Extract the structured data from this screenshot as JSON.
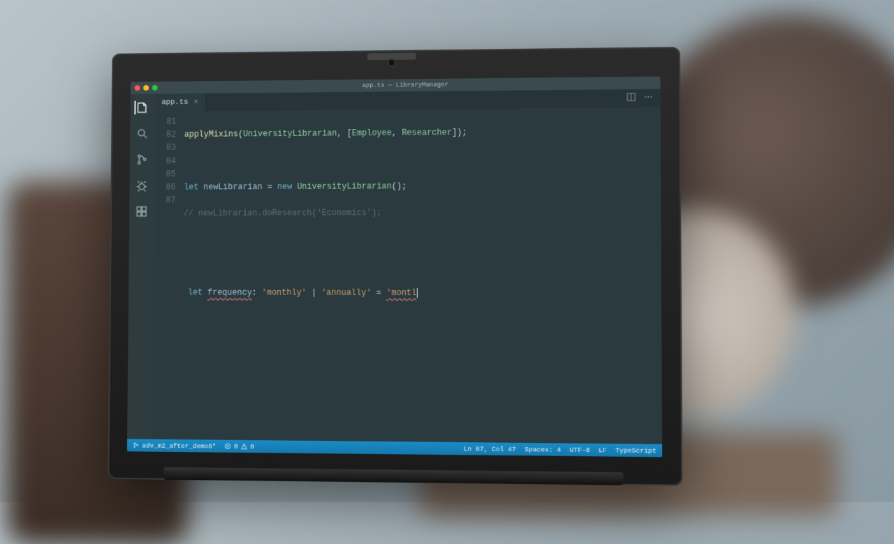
{
  "window": {
    "title": "app.ts — LibraryManager"
  },
  "tab": {
    "filename": "app.ts"
  },
  "editor": {
    "line_numbers": [
      "81",
      "82",
      "83",
      "84",
      "85",
      "86",
      "87"
    ],
    "code": {
      "l81": {
        "fn": "applyMixins",
        "open": "(",
        "cls1": "UniversityLibrarian",
        "mid": ", [",
        "cls2": "Employee",
        "sep": ", ",
        "cls3": "Researcher",
        "end": "]);"
      },
      "l83": {
        "kw_let": "let ",
        "var": "newLibrarian",
        "eq": " = ",
        "kw_new": "new ",
        "cls": "UniversityLibrarian",
        "end": "();"
      },
      "l84": {
        "comment": "// newLibrarian.doResearch('Economics');"
      },
      "l87": {
        "kw_let": "let ",
        "var": "frequency",
        "colon": ": ",
        "t1": "'monthly'",
        "pipe": " | ",
        "t2": "'annually'",
        "eq": " = ",
        "val": "'montl"
      }
    }
  },
  "status": {
    "branch": "adv_m2_after_demo6*",
    "errors": "0",
    "warnings": "0",
    "position": "Ln 87, Col 47",
    "spaces": "Spaces: 4",
    "encoding": "UTF-8",
    "eol": "LF",
    "language": "TypeScript"
  },
  "icons": {
    "files": "files-icon",
    "search": "search-icon",
    "git": "git-icon",
    "debug": "debug-icon",
    "extensions": "extensions-icon",
    "split": "split-editor-icon",
    "more": "more-icon"
  }
}
